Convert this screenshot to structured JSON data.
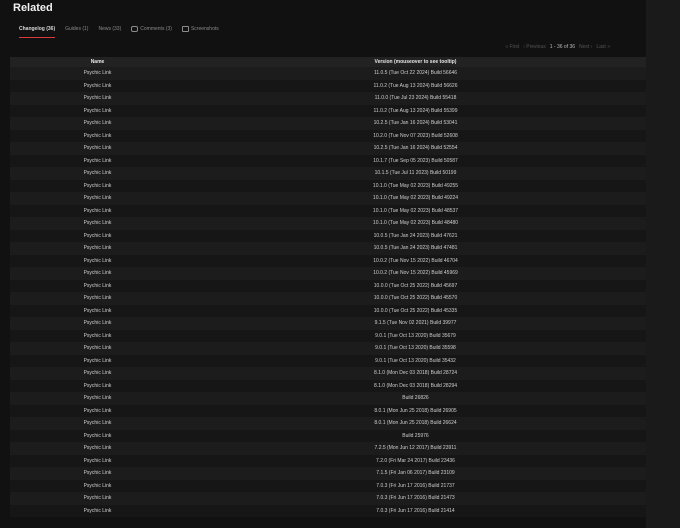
{
  "title": "Related",
  "tabs": [
    {
      "label": "Changelog (36)",
      "active": true,
      "icon": ""
    },
    {
      "label": "Guides (1)",
      "active": false,
      "icon": ""
    },
    {
      "label": "News (33)",
      "active": false,
      "icon": ""
    },
    {
      "label": "Comments (3)",
      "active": false,
      "icon": "comment-icon"
    },
    {
      "label": "Screenshots",
      "active": false,
      "icon": "image-icon"
    }
  ],
  "pager": {
    "first": "« First",
    "prev": "‹ Previous",
    "status": "1 - 36 of 36",
    "next": "Next ›",
    "last": "Last »"
  },
  "columns": {
    "name": "Name",
    "version": "Version (mouseover to see tooltip)"
  },
  "rows": [
    {
      "name": "Psychic Link",
      "version": "11.0.5 (Tue Oct 22 2024) Build 56646"
    },
    {
      "name": "Psychic Link",
      "version": "11.0.2 (Tue Aug 13 2024) Build 56626"
    },
    {
      "name": "Psychic Link",
      "version": "11.0.0 (Tue Jul 23 2024) Build 55418"
    },
    {
      "name": "Psychic Link",
      "version": "11.0.2 (Tue Aug 13 2024) Build 55399"
    },
    {
      "name": "Psychic Link",
      "version": "10.2.5 (Tue Jan 16 2024) Build 53041"
    },
    {
      "name": "Psychic Link",
      "version": "10.2.0 (Tue Nov 07 2023) Build 52608"
    },
    {
      "name": "Psychic Link",
      "version": "10.2.5 (Tue Jan 16 2024) Build 52554"
    },
    {
      "name": "Psychic Link",
      "version": "10.1.7 (Tue Sep 05 2023) Build 50587"
    },
    {
      "name": "Psychic Link",
      "version": "10.1.5 (Tue Jul 11 2023) Build 50199"
    },
    {
      "name": "Psychic Link",
      "version": "10.1.0 (Tue May 02 2023) Build 49255"
    },
    {
      "name": "Psychic Link",
      "version": "10.1.0 (Tue May 02 2023) Build 49224"
    },
    {
      "name": "Psychic Link",
      "version": "10.1.0 (Tue May 02 2023) Build 48537"
    },
    {
      "name": "Psychic Link",
      "version": "10.1.0 (Tue May 02 2023) Build 48480"
    },
    {
      "name": "Psychic Link",
      "version": "10.0.5 (Tue Jan 24 2023) Build 47621"
    },
    {
      "name": "Psychic Link",
      "version": "10.0.5 (Tue Jan 24 2023) Build 47481"
    },
    {
      "name": "Psychic Link",
      "version": "10.0.2 (Tue Nov 15 2022) Build 46704"
    },
    {
      "name": "Psychic Link",
      "version": "10.0.2 (Tue Nov 15 2022) Build 45969"
    },
    {
      "name": "Psychic Link",
      "version": "10.0.0 (Tue Oct 25 2022) Build 45697"
    },
    {
      "name": "Psychic Link",
      "version": "10.0.0 (Tue Oct 25 2022) Build 45570"
    },
    {
      "name": "Psychic Link",
      "version": "10.0.0 (Tue Oct 25 2022) Build 45335"
    },
    {
      "name": "Psychic Link",
      "version": "9.1.5 (Tue Nov 02 2021) Build 39977"
    },
    {
      "name": "Psychic Link",
      "version": "9.0.1 (Tue Oct 13 2020) Build 35679"
    },
    {
      "name": "Psychic Link",
      "version": "9.0.1 (Tue Oct 13 2020) Build 35598"
    },
    {
      "name": "Psychic Link",
      "version": "9.0.1 (Tue Oct 13 2020) Build 35432"
    },
    {
      "name": "Psychic Link",
      "version": "8.1.0 (Mon Dec 03 2018) Build 28724"
    },
    {
      "name": "Psychic Link",
      "version": "8.1.0 (Mon Dec 03 2018) Build 28294"
    },
    {
      "name": "Psychic Link",
      "version": "Build 26826"
    },
    {
      "name": "Psychic Link",
      "version": "8.0.1 (Mon Jun 25 2018) Build 26905"
    },
    {
      "name": "Psychic Link",
      "version": "8.0.1 (Mon Jun 25 2018) Build 26624"
    },
    {
      "name": "Psychic Link",
      "version": "Build 25976"
    },
    {
      "name": "Psychic Link",
      "version": "7.2.5 (Mon Jun 12 2017) Build 23911"
    },
    {
      "name": "Psychic Link",
      "version": "7.2.0 (Fri Mar 24 2017) Build 23436"
    },
    {
      "name": "Psychic Link",
      "version": "7.1.5 (Fri Jan 06 2017) Build 23109"
    },
    {
      "name": "Psychic Link",
      "version": "7.0.3 (Fri Jun 17 2016) Build 21737"
    },
    {
      "name": "Psychic Link",
      "version": "7.0.3 (Fri Jun 17 2016) Build 21473"
    },
    {
      "name": "Psychic Link",
      "version": "7.0.3 (Fri Jun 17 2016) Build 21414"
    }
  ]
}
